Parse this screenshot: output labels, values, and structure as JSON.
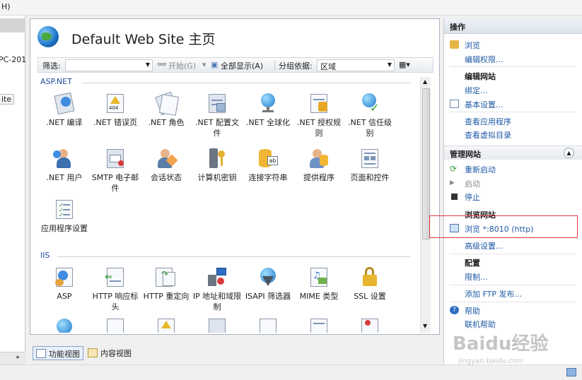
{
  "menubar": {
    "fragment": "H)"
  },
  "left_pane": {
    "host_fragment": "PC-201",
    "site_fragment": "ite"
  },
  "main": {
    "title": "Default Web Site 主页",
    "filter": {
      "label": "筛选:",
      "value": "",
      "start_label": "开始(G)",
      "show_all_label": "全部显示(A)",
      "group_by_label": "分组依据:",
      "group_by_value": "区域"
    },
    "groups": [
      {
        "name": "ASP.NET",
        "items": [
          {
            "label": ".NET 编译",
            "icon": "dotnet-compilation-icon"
          },
          {
            "label": ".NET 错误页",
            "icon": "dotnet-error-pages-icon"
          },
          {
            "label": ".NET 角色",
            "icon": "dotnet-roles-icon"
          },
          {
            "label": ".NET 配置文件",
            "icon": "dotnet-profile-icon"
          },
          {
            "label": ".NET 全球化",
            "icon": "dotnet-globalization-icon"
          },
          {
            "label": ".NET 授权规则",
            "icon": "dotnet-authorization-icon"
          },
          {
            "label": ".NET 信任级别",
            "icon": "dotnet-trust-levels-icon"
          },
          {
            "label": ".NET 用户",
            "icon": "dotnet-users-icon"
          },
          {
            "label": "SMTP 电子邮件",
            "icon": "smtp-email-icon"
          },
          {
            "label": "会话状态",
            "icon": "session-state-icon"
          },
          {
            "label": "计算机密钥",
            "icon": "machine-key-icon"
          },
          {
            "label": "连接字符串",
            "icon": "connection-strings-icon"
          },
          {
            "label": "提供程序",
            "icon": "providers-icon"
          },
          {
            "label": "页面和控件",
            "icon": "pages-controls-icon"
          },
          {
            "label": "应用程序设置",
            "icon": "app-settings-icon"
          }
        ]
      },
      {
        "name": "IIS",
        "items": [
          {
            "label": "ASP",
            "icon": "asp-icon"
          },
          {
            "label": "HTTP 响应标头",
            "icon": "http-response-headers-icon"
          },
          {
            "label": "HTTP 重定向",
            "icon": "http-redirect-icon"
          },
          {
            "label": "IP 地址和域限制",
            "icon": "ip-domain-restrictions-icon"
          },
          {
            "label": "ISAPI 筛选器",
            "icon": "isapi-filters-icon"
          },
          {
            "label": "MIME 类型",
            "icon": "mime-types-icon"
          },
          {
            "label": "SSL 设置",
            "icon": "ssl-settings-icon"
          }
        ]
      }
    ]
  },
  "bottom_tabs": {
    "features_view": "功能视图",
    "content_view": "内容视图"
  },
  "actions": {
    "header": "操作",
    "explore": "浏览",
    "edit_permissions": "编辑权限...",
    "edit_site_title": "编辑网站",
    "bindings": "绑定...",
    "basic_settings": "基本设置...",
    "view_applications": "查看应用程序",
    "view_virtual_dirs": "查看虚拟目录",
    "manage_site_title": "管理网站",
    "restart": "重新启动",
    "start": "启动",
    "stop": "停止",
    "browse_site_title": "浏览网站",
    "browse_port": "浏览 *:8010 (http)",
    "advanced_settings": "高级设置...",
    "config_title": "配置",
    "limits": "限制...",
    "add_ftp": "添加 FTP 发布...",
    "help": "帮助",
    "online_help": "联机帮助"
  },
  "watermark": {
    "brand": "Baidu经验",
    "url": "jingyan.baidu.com"
  },
  "colors": {
    "link": "#1f5aa6",
    "highlight_box": "#e03a3a",
    "group_header": "#1f4f9e"
  }
}
